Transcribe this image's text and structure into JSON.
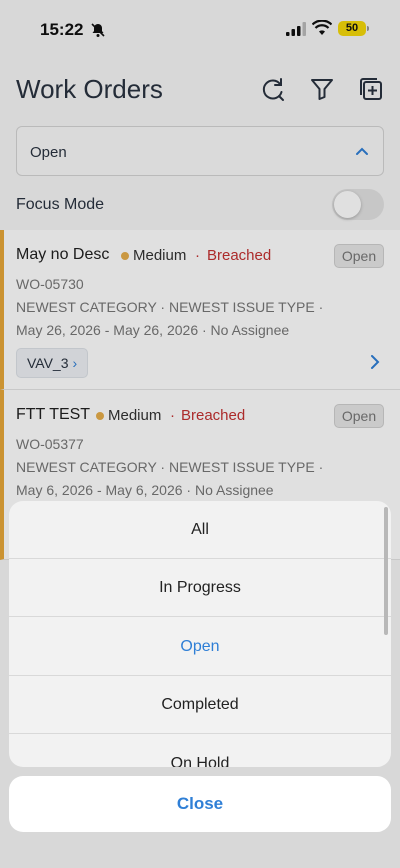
{
  "status_bar": {
    "time": "15:22",
    "battery": "50"
  },
  "header": {
    "title": "Work Orders"
  },
  "filter": {
    "selected": "Open"
  },
  "focus_mode": {
    "label": "Focus Mode",
    "enabled": false
  },
  "work_orders": [
    {
      "title": "May no Desc",
      "priority": "Medium",
      "sla": "Breached",
      "status": "Open",
      "id": "WO-05730",
      "category_line": "NEWEST CATEGORY · NEWEST ISSUE TYPE ·",
      "date_line": "May 26, 2026 - May 26, 2026 · No Assignee",
      "asset": "VAV_3"
    },
    {
      "title": "FTT TEST",
      "priority": "Medium",
      "sla": "Breached",
      "status": "Open",
      "id": "WO-05377",
      "category_line": "NEWEST CATEGORY · NEWEST ISSUE TYPE ·",
      "date_line": "May 6, 2026 - May 6, 2026 · No Assignee"
    }
  ],
  "action_sheet": {
    "options": [
      "All",
      "In Progress",
      "Open",
      "Completed",
      "On Hold"
    ],
    "selected": "Open",
    "close_label": "Close"
  },
  "colors": {
    "accent": "#2f7fd6",
    "breached": "#c43131",
    "priority_medium": "#e6ad4a",
    "card_border": "#e8a83a"
  },
  "icons": {
    "header": [
      "refresh-history-icon",
      "filter-icon",
      "add-square-icon"
    ]
  }
}
